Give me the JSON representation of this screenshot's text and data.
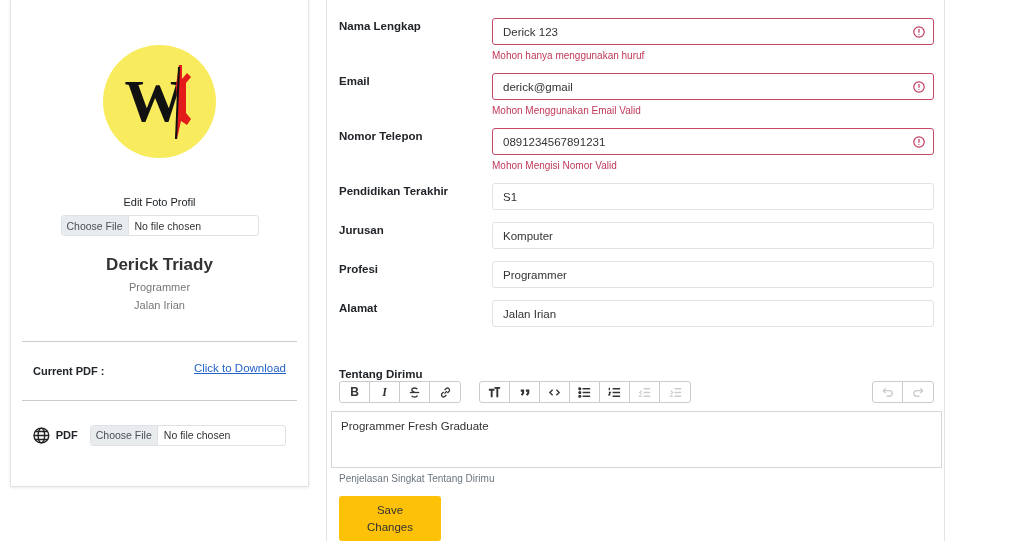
{
  "profile": {
    "logo_letter": "W",
    "edit_photo_label": "Edit Foto Profil",
    "photo_input": {
      "button": "Choose File",
      "status": "No file chosen"
    },
    "name": "Derick Triady",
    "profession": "Programmer",
    "address": "Jalan Irian",
    "current_pdf_label": "Current PDF :",
    "download_link": "Click to Download",
    "pdf_label": "PDF",
    "pdf_input": {
      "button": "Choose File",
      "status": "No file chosen"
    }
  },
  "form": {
    "fields": [
      {
        "label": "Nama Lengkap",
        "value": "Derick 123",
        "invalid": true,
        "error": "Mohon hanya menggunakan huruf"
      },
      {
        "label": "Email",
        "value": "derick@gmail",
        "invalid": true,
        "error": "Mohon Menggunakan Email Valid"
      },
      {
        "label": "Nomor Telepon",
        "value": "0891234567891231",
        "invalid": true,
        "error": "Mohon Mengisi Nomor Valid"
      },
      {
        "label": "Pendidikan Terakhir",
        "value": "S1",
        "invalid": false
      },
      {
        "label": "Jurusan",
        "value": "Komputer",
        "invalid": false
      },
      {
        "label": "Profesi",
        "value": "Programmer",
        "invalid": false
      },
      {
        "label": "Alamat",
        "value": "Jalan Irian",
        "invalid": false
      }
    ],
    "about": {
      "label": "Tentang Dirimu",
      "toolbar": [
        [
          {
            "kind": "bold",
            "label": "B",
            "disabled": false
          },
          {
            "kind": "italic",
            "label": "I",
            "disabled": false
          },
          {
            "kind": "strike",
            "disabled": false
          },
          {
            "kind": "link",
            "disabled": false
          }
        ],
        [
          {
            "kind": "heading",
            "disabled": false
          },
          {
            "kind": "quote",
            "disabled": false
          },
          {
            "kind": "code",
            "disabled": false
          },
          {
            "kind": "bullets",
            "disabled": false
          },
          {
            "kind": "numbers",
            "disabled": false
          },
          {
            "kind": "outdent",
            "disabled": true
          },
          {
            "kind": "indent",
            "disabled": true
          }
        ],
        [
          {
            "kind": "undo",
            "disabled": true
          },
          {
            "kind": "redo",
            "disabled": true
          }
        ]
      ],
      "text": "Programmer Fresh Graduate",
      "help": "Penjelasan Singkat Tentang Dirimu"
    },
    "save_button": "Save Changes"
  }
}
